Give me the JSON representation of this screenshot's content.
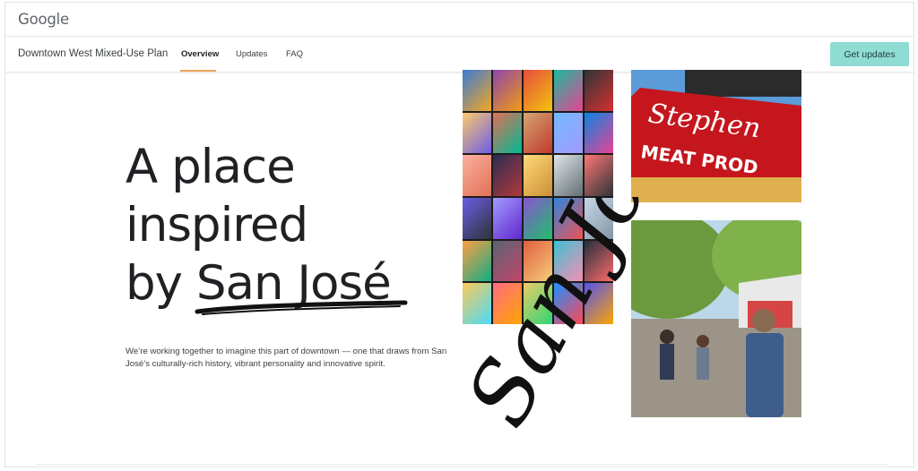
{
  "header": {
    "logo_text": "Google"
  },
  "nav": {
    "plan_title": "Downtown West Mixed-Use Plan",
    "tabs": [
      {
        "label": "Overview",
        "active": true
      },
      {
        "label": "Updates",
        "active": false
      },
      {
        "label": "FAQ",
        "active": false
      }
    ],
    "cta_label": "Get updates",
    "cta_color": "#8fdcd5",
    "active_tab_underline_color": "#f0a35a"
  },
  "hero": {
    "headline_lines": [
      "A place",
      "inspired",
      "by San José"
    ],
    "description": "We’re working together to imagine this part of downtown — one that draws from San José’s culturally-rich history, vibrant personality and innovative spirit.",
    "script_text": "San José"
  },
  "images": {
    "murals": {
      "description_icon": "mural-collage-photo"
    },
    "sign": {
      "sign_text": "Stephen's MEAT PRODUCTS",
      "description_icon": "neon-sign-photo"
    },
    "street": {
      "description_icon": "street-market-photo"
    }
  }
}
